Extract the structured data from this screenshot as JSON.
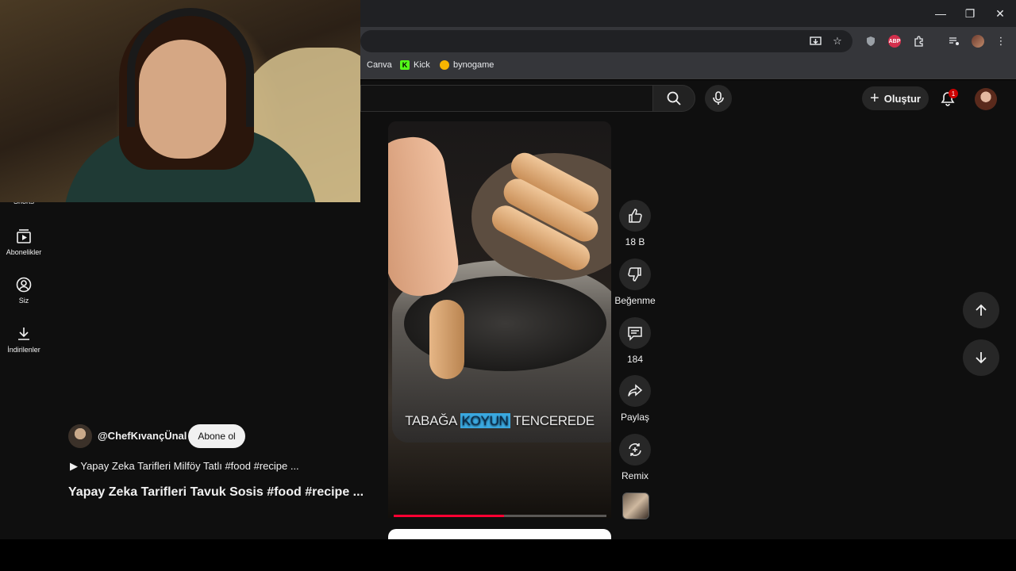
{
  "browser": {
    "window_controls": {
      "minimize": "—",
      "restore": "❐",
      "close": "✕"
    },
    "bookmarks": [
      {
        "label": "Canva",
        "icon": "canva-icon"
      },
      {
        "label": "Kick",
        "icon": "kick-icon"
      },
      {
        "label": "bynogame",
        "icon": "bynogame-icon"
      }
    ],
    "extension_badge": "ABP"
  },
  "masthead": {
    "create_label": "Oluştur",
    "notification_count": "1"
  },
  "guide": {
    "items": [
      {
        "label": "Shorts",
        "icon": "shorts-icon"
      },
      {
        "label": "Abonelikler",
        "icon": "subscriptions-icon"
      },
      {
        "label": "Siz",
        "icon": "you-icon"
      },
      {
        "label": "İndirilenler",
        "icon": "downloads-icon"
      }
    ]
  },
  "video": {
    "caption_before": "TABAĞA ",
    "caption_highlight": "KOYUN",
    "caption_after": " TENCEREDE",
    "progress": 0.52
  },
  "actions": {
    "like_count": "18 B",
    "dislike_label": "Beğenme",
    "comment_count": "184",
    "share_label": "Paylaş",
    "remix_label": "Remix"
  },
  "channel": {
    "handle": "@ChefKıvançÜnal",
    "subscribe_label": "Abone ol"
  },
  "meta": {
    "playlist_line": "▶ Yapay Zeka Tarifleri Milföy Tatlı #food  #recipe  ...",
    "title": "Yapay Zeka Tarifleri Tavuk Sosis #food  #recipe ..."
  },
  "colors": {
    "accent_red": "#ff0033",
    "background": "#0f0f0f",
    "chip": "#272727"
  }
}
